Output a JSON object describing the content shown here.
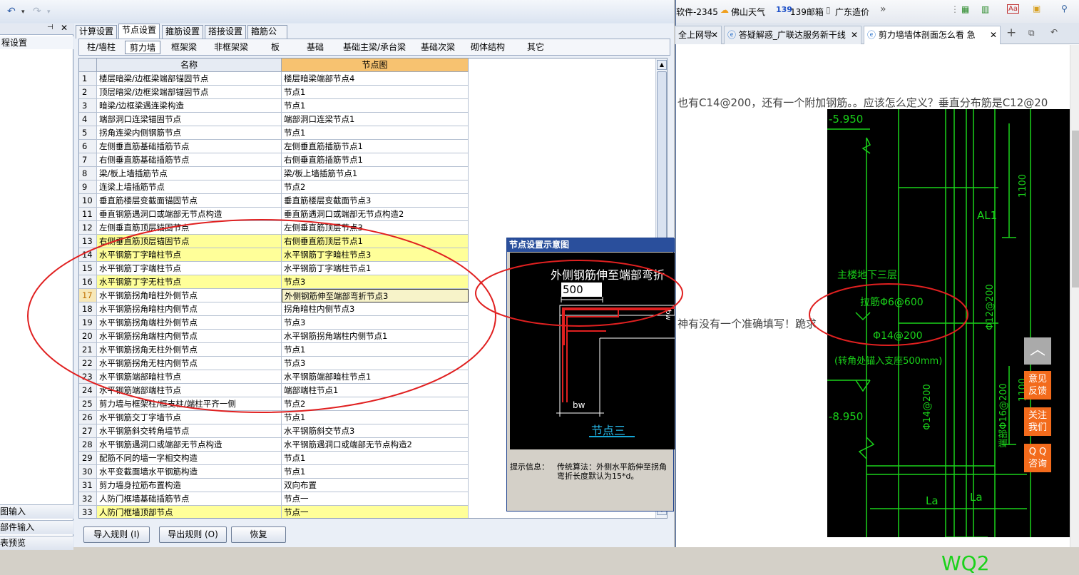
{
  "app": {
    "left_panel": {
      "title": "程设置",
      "bottom_items": [
        "图输入",
        "部件输入",
        "表预览"
      ]
    },
    "tabs_top": [
      "计算设置",
      "节点设置",
      "箍筋设置",
      "搭接设置",
      "箍筋公式"
    ],
    "tabs_top_active": 1,
    "tabs_sub": [
      "柱/墙柱",
      "剪力墙",
      "框架梁",
      "非框架梁",
      "板",
      "基础",
      "基础主梁/承台梁",
      "基础次梁",
      "砌体结构",
      "其它"
    ],
    "tabs_sub_active": 1,
    "grid": {
      "headers": [
        "名称",
        "节点图"
      ],
      "rows": [
        [
          "1",
          "楼层暗梁/边框梁端部锚固节点",
          "楼层暗梁端部节点4"
        ],
        [
          "2",
          "顶层暗梁/边框梁端部锚固节点",
          "节点1"
        ],
        [
          "3",
          "暗梁/边框梁遇连梁构造",
          "节点1"
        ],
        [
          "4",
          "端部洞口连梁锚固节点",
          "端部洞口连梁节点1"
        ],
        [
          "5",
          "拐角连梁内侧钢筋节点",
          "节点1"
        ],
        [
          "6",
          "左侧垂直筋基础插筋节点",
          "左侧垂直筋插筋节点1"
        ],
        [
          "7",
          "右侧垂直筋基础插筋节点",
          "右侧垂直筋插筋节点1"
        ],
        [
          "8",
          "梁/板上墙插筋节点",
          "梁/板上墙插筋节点1"
        ],
        [
          "9",
          "连梁上墙插筋节点",
          "节点2"
        ],
        [
          "10",
          "垂直筋楼层变截面锚固节点",
          "垂直筋楼层变截面节点3"
        ],
        [
          "11",
          "垂直钢筋遇洞口或端部无节点构造",
          "垂直筋遇洞口或端部无节点构造2"
        ],
        [
          "12",
          "左侧垂直筋顶层锚固节点",
          "左侧垂直筋顶层节点3"
        ],
        [
          "13",
          "右侧垂直筋顶层锚固节点",
          "右侧垂直筋顶层节点1"
        ],
        [
          "14",
          "水平钢筋丁字暗柱节点",
          "水平钢筋丁字暗柱节点3"
        ],
        [
          "15",
          "水平钢筋丁字端柱节点",
          "水平钢筋丁字端柱节点1"
        ],
        [
          "16",
          "水平钢筋丁字无柱节点",
          "节点3"
        ],
        [
          "17",
          "水平钢筋拐角暗柱外侧节点",
          "外侧钢筋伸至端部弯折节点3"
        ],
        [
          "18",
          "水平钢筋拐角暗柱内侧节点",
          "拐角暗柱内侧节点3"
        ],
        [
          "19",
          "水平钢筋拐角端柱外侧节点",
          "节点3"
        ],
        [
          "20",
          "水平钢筋拐角端柱内侧节点",
          "水平钢筋拐角端柱内侧节点1"
        ],
        [
          "21",
          "水平钢筋拐角无柱外侧节点",
          "节点1"
        ],
        [
          "22",
          "水平钢筋拐角无柱内侧节点",
          "节点3"
        ],
        [
          "23",
          "水平钢筋端部暗柱节点",
          "水平钢筋端部暗柱节点1"
        ],
        [
          "24",
          "水平钢筋端部端柱节点",
          "端部端柱节点1"
        ],
        [
          "25",
          "剪力墙与框架柱/框支柱/端柱平齐一侧",
          "节点2"
        ],
        [
          "26",
          "水平钢筋交丁字墙节点",
          "节点1"
        ],
        [
          "27",
          "水平钢筋斜交转角墙节点",
          "水平钢筋斜交节点3"
        ],
        [
          "28",
          "水平钢筋遇洞口或端部无节点构造",
          "水平钢筋遇洞口或端部无节点构造2"
        ],
        [
          "29",
          "配筋不同的墙一字相交构造",
          "节点1"
        ],
        [
          "30",
          "水平变截面墙水平钢筋构造",
          "节点1"
        ],
        [
          "31",
          "剪力墙身拉筋布置构造",
          "双向布置"
        ],
        [
          "32",
          "人防门框墙基础插筋节点",
          "节点一"
        ],
        [
          "33",
          "人防门框墙顶部节点",
          "节点一"
        ]
      ],
      "yellow_rows": [
        13,
        14,
        16,
        33
      ]
    },
    "buttons": [
      "导入规则 (I)",
      "导出规则 (O)",
      "恢复"
    ],
    "dialog": {
      "title": "节点设置示意图",
      "caption": "外侧钢筋伸至端部弯折",
      "value": "500",
      "dim_label": "bw",
      "node_label": "节点三",
      "hint_label": "提示信息：",
      "hint_text1": "传统算法：外侧水平筋伸至拐角",
      "hint_text2": "弯折长度默认为15*d。"
    }
  },
  "browser": {
    "bookmarks": [
      "软件-2345",
      "佛山天气",
      "139邮箱",
      "广东造价"
    ],
    "tabs": [
      "全上网导",
      "答疑解惑_广联达服务新干线",
      "剪力墙墙体剖面怎么看 急"
    ],
    "text1": "也有C14@200，还有一个附加钢筋。。应该怎么定义？垂直分布筋是C12@20",
    "text2": "神有没有一个准确填写！跪求",
    "side_buttons": [
      "意见\n反馈",
      "关注\n我们",
      "Q Q\n咨询"
    ],
    "cad": {
      "labels": [
        "-5.950",
        "AL1",
        "1100",
        "主楼地下三层",
        "拉筋Φ6@600",
        "Φ14@200",
        "(转角处锚入支座500mm)",
        "Φ12@200",
        "-8.950",
        "Φ14@200",
        "端部Φ16@200",
        "1100",
        "La",
        "La",
        "WQ2"
      ]
    }
  },
  "colors": {
    "yellow": "#ffff99",
    "red": "#e02020",
    "cad_green": "#1ad21a",
    "orange": "#f36b1c"
  }
}
